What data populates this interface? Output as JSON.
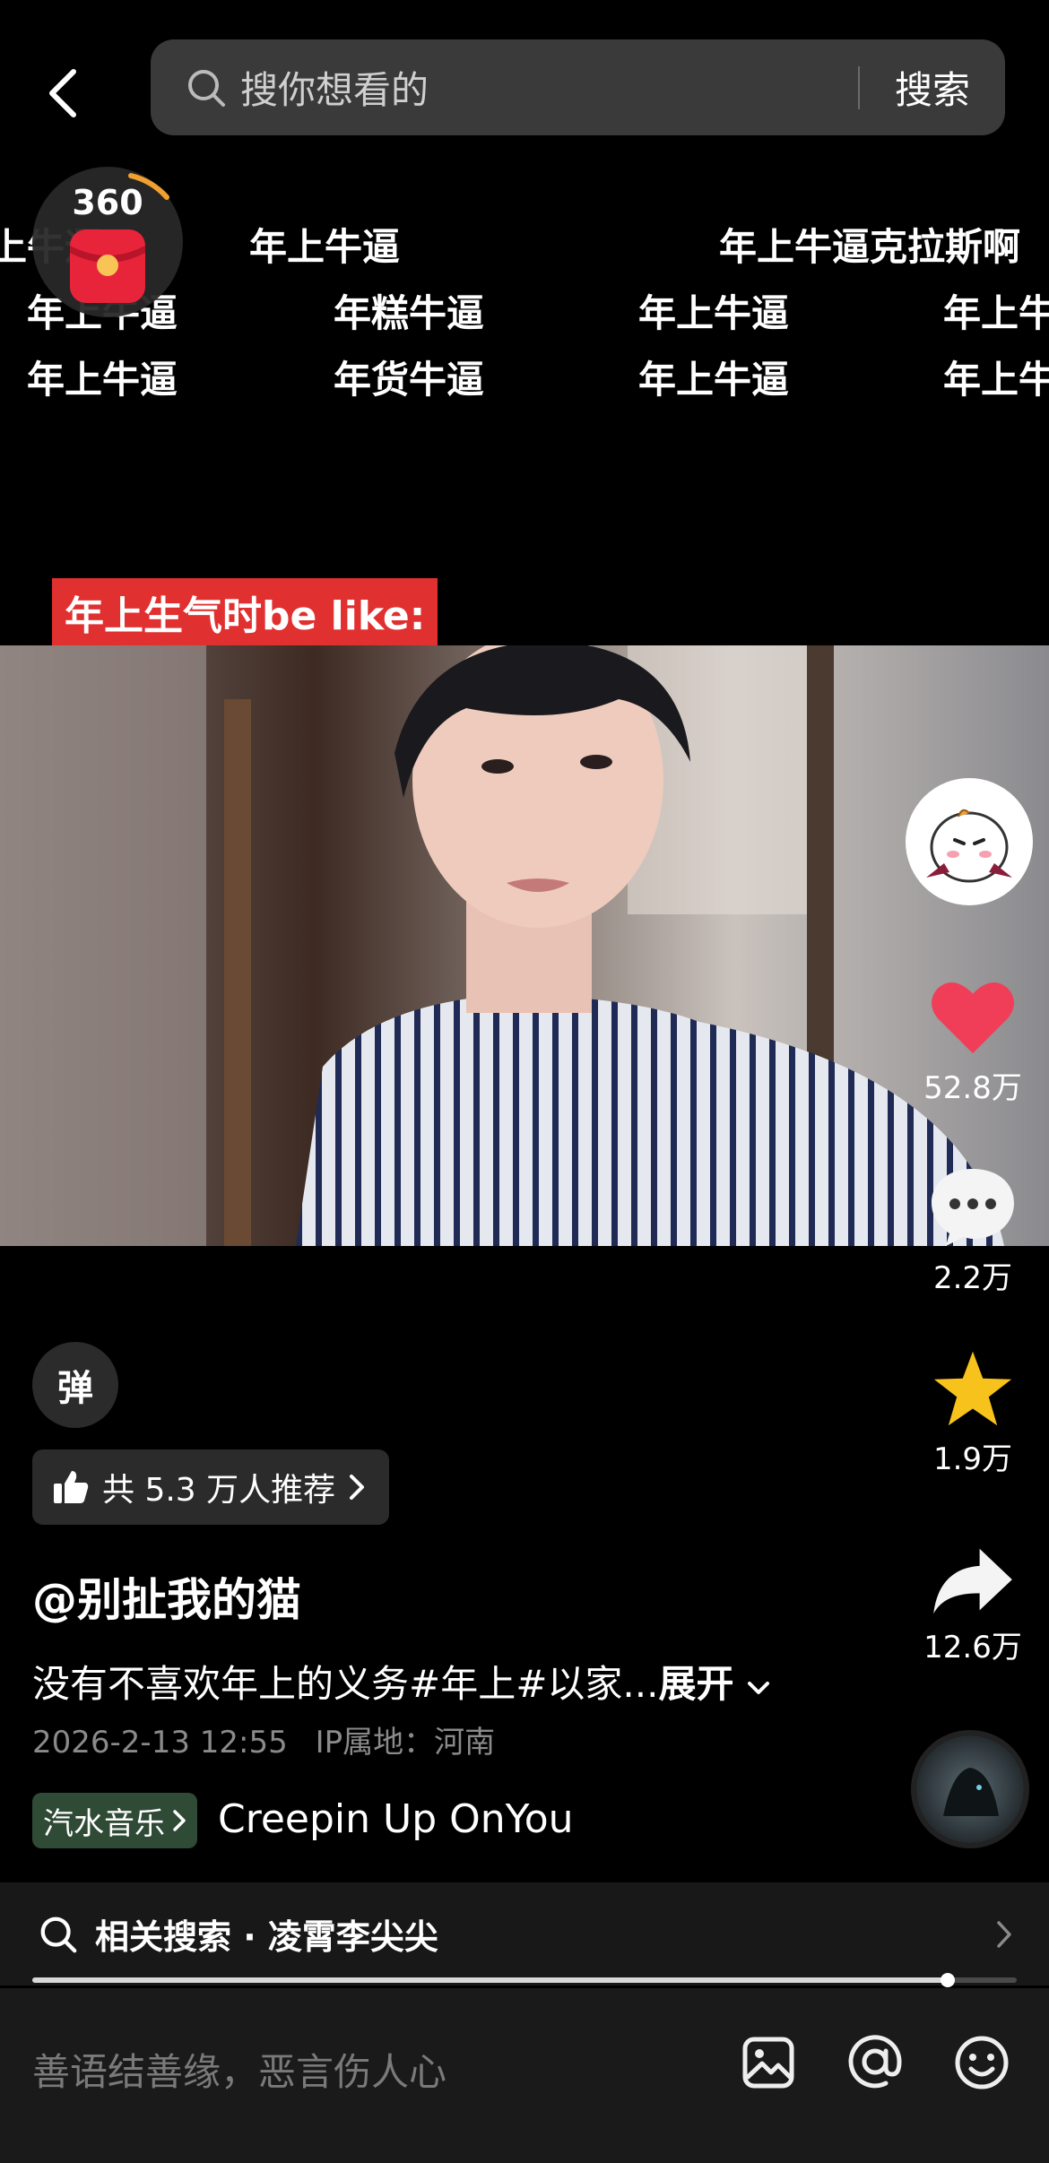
{
  "search": {
    "placeholder": "搜你想看的",
    "button": "搜索"
  },
  "widget": {
    "number": "360"
  },
  "danmaku_rows": [
    [
      "上牛逼",
      "年上牛逼",
      "年上牛逼克拉斯啊"
    ],
    [
      "年上牛逼",
      "年糕牛逼",
      "年上牛逼",
      "年上牛"
    ],
    [
      "年上牛逼",
      "年货牛逼",
      "年上牛逼",
      "年上牛"
    ]
  ],
  "video": {
    "caption": "年上生气时be like:"
  },
  "rail": {
    "likes": "52.8万",
    "comments": "2.2万",
    "favorites": "1.9万",
    "shares": "12.6万"
  },
  "colors": {
    "like": "#f03e58",
    "favorite": "#f7c21c",
    "caption_bg": "#e0302f"
  },
  "info": {
    "danmu_toggle": "弹",
    "recommend": "共 5.3 万人推荐",
    "author": "@别扯我的猫",
    "description": "没有不喜欢年上的义务#年上#以家...",
    "expand": "展开",
    "datetime": "2026-2-13 12:55",
    "ip": "IP属地：河南",
    "music_tag": "汽水音乐",
    "music_name": "Creepin Up OnYou"
  },
  "related": {
    "label": "相关搜索 · 凌霄李尖尖"
  },
  "progress": 0.93,
  "comment": {
    "placeholder": "善语结善缘，恶言伤人心"
  },
  "icons": [
    "back-icon",
    "search-icon",
    "red-packet-icon",
    "like-icon",
    "comment-icon",
    "favorite-icon",
    "share-icon",
    "thumb-up-icon",
    "chevron-right-icon",
    "chevron-down-icon",
    "image-icon",
    "at-icon",
    "emoji-icon"
  ]
}
